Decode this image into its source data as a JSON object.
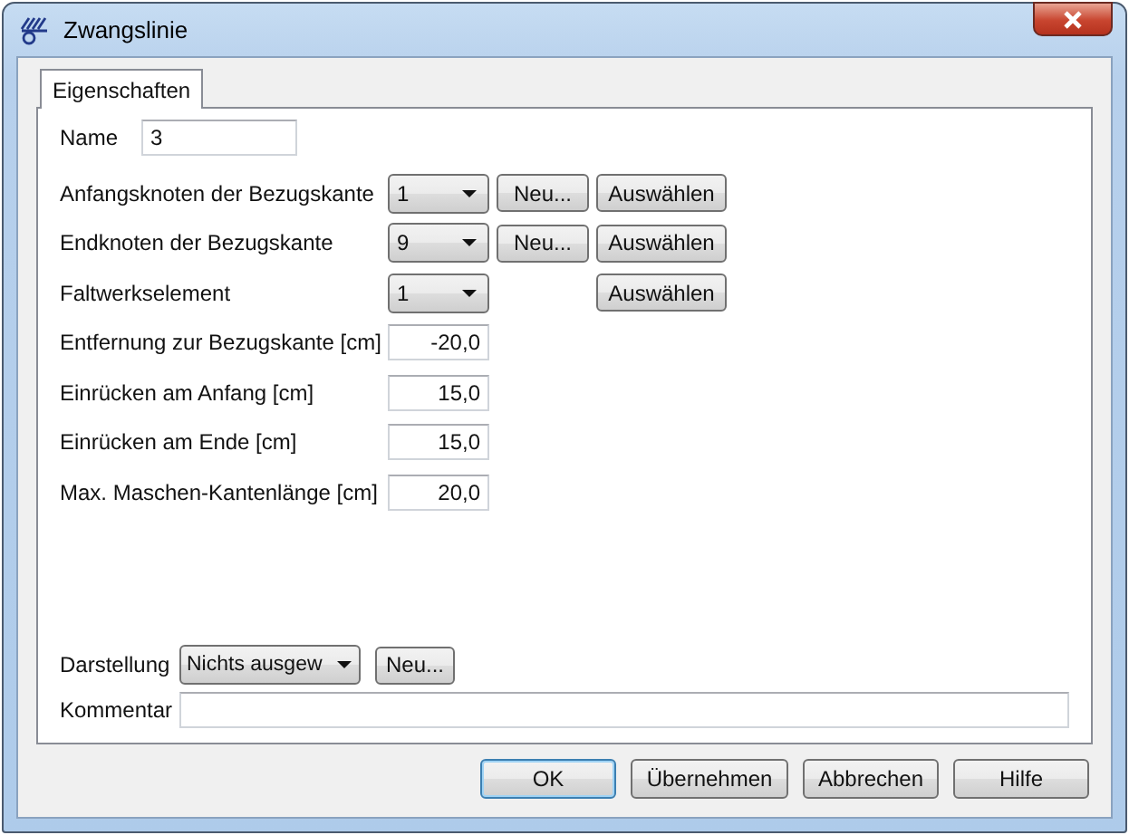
{
  "window": {
    "title": "Zwangslinie"
  },
  "tabs": [
    {
      "label": "Eigenschaften",
      "selected": true
    }
  ],
  "name_field": {
    "label": "Name",
    "value": "3"
  },
  "rows": [
    {
      "kind": "select",
      "label": "Anfangsknoten der Bezugskante",
      "value": "1",
      "new_button": "Neu...",
      "pick_button": "Auswählen"
    },
    {
      "kind": "select",
      "label": "Endknoten der Bezugskante",
      "value": "9",
      "new_button": "Neu...",
      "pick_button": "Auswählen"
    },
    {
      "kind": "select",
      "label": "Faltwerkselement",
      "value": "1",
      "pick_button": "Auswählen"
    },
    {
      "kind": "number",
      "label": "Entfernung zur Bezugskante [cm]",
      "value": "-20,0"
    },
    {
      "kind": "number",
      "label": "Einrücken am Anfang [cm]",
      "value": "15,0"
    },
    {
      "kind": "number",
      "label": "Einrücken am Ende [cm]",
      "value": "15,0"
    },
    {
      "kind": "number",
      "label": "Max. Maschen-Kantenlänge [cm]",
      "value": "20,0"
    }
  ],
  "display": {
    "label": "Darstellung",
    "value": "Nichts ausgew",
    "new_button": "Neu..."
  },
  "comment": {
    "label": "Kommentar"
  },
  "buttons": [
    {
      "label": "OK",
      "default": true
    },
    {
      "label": "Übernehmen",
      "default": false
    },
    {
      "label": "Abbrechen",
      "default": false
    },
    {
      "label": "Hilfe",
      "default": false
    }
  ]
}
